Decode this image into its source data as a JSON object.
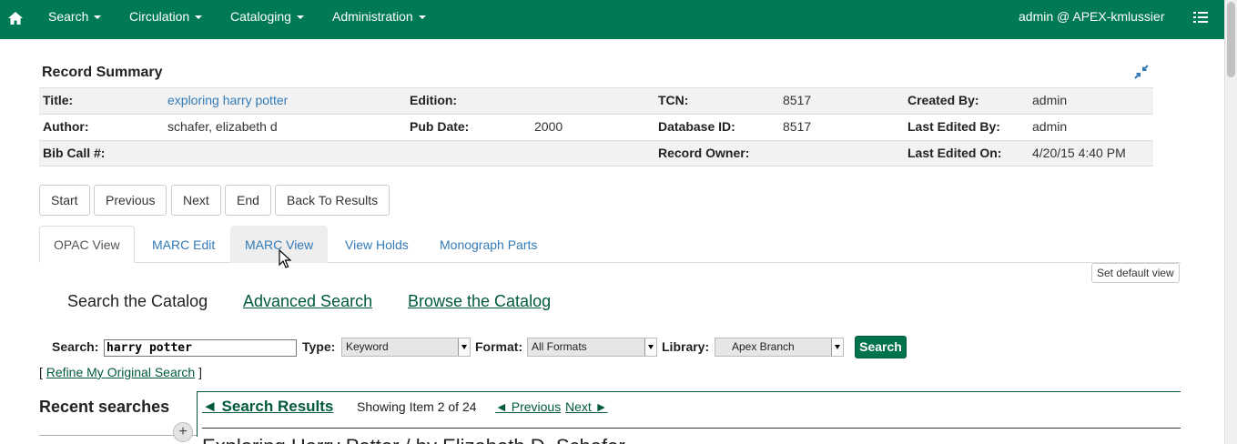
{
  "navbar": {
    "menus": [
      "Search",
      "Circulation",
      "Cataloging",
      "Administration"
    ],
    "user": "admin @ APEX-kmlussier",
    "home_icon": "home-icon",
    "list_icon": "list-icon",
    "bg_color": "#007a54"
  },
  "record_summary": {
    "heading": "Record Summary",
    "rows": [
      {
        "c1_label": "Title:",
        "c1_value": "exploring harry potter",
        "c2_label": "Edition:",
        "c2_value": "",
        "c3_label": "TCN:",
        "c3_value": "8517",
        "c4_label": "Created By:",
        "c4_value": "admin"
      },
      {
        "c1_label": "Author:",
        "c1_value": "schafer, elizabeth d",
        "c2_label": "Pub Date:",
        "c2_value": "2000",
        "c3_label": "Database ID:",
        "c3_value": "8517",
        "c4_label": "Last Edited By:",
        "c4_value": "admin"
      },
      {
        "c1_label": "Bib Call #:",
        "c1_value": "",
        "c2_label": "",
        "c2_value": "",
        "c3_label": "Record Owner:",
        "c3_value": "",
        "c4_label": "Last Edited On:",
        "c4_value": "4/20/15 4:40 PM"
      }
    ]
  },
  "nav_buttons": [
    "Start",
    "Previous",
    "Next",
    "End",
    "Back To Results"
  ],
  "tabs": [
    "OPAC View",
    "MARC Edit",
    "MARC View",
    "View Holds",
    "Monograph Parts"
  ],
  "set_default_view": "Set default view",
  "opac": {
    "search_catalog": "Search the Catalog",
    "advanced_search": "Advanced Search",
    "browse_catalog": "Browse the Catalog",
    "search_label": "Search:",
    "search_value": "harry potter",
    "type_label": "Type:",
    "type_value": "Keyword",
    "format_label": "Format:",
    "format_value": "All Formats",
    "library_label": "Library:",
    "library_value": "Apex Branch",
    "search_button": "Search",
    "refine_open": "[",
    "refine_link": "Refine My Original Search",
    "refine_close": "]",
    "recent_searches": "Recent searches",
    "plus": "+",
    "search_results": "◄ Search Results",
    "showing": "Showing Item 2 of 24",
    "previous": "◄ Previous",
    "next": "Next ►",
    "result_title": "Exploring Harry Potter / by Elizabeth D. Schafer."
  }
}
